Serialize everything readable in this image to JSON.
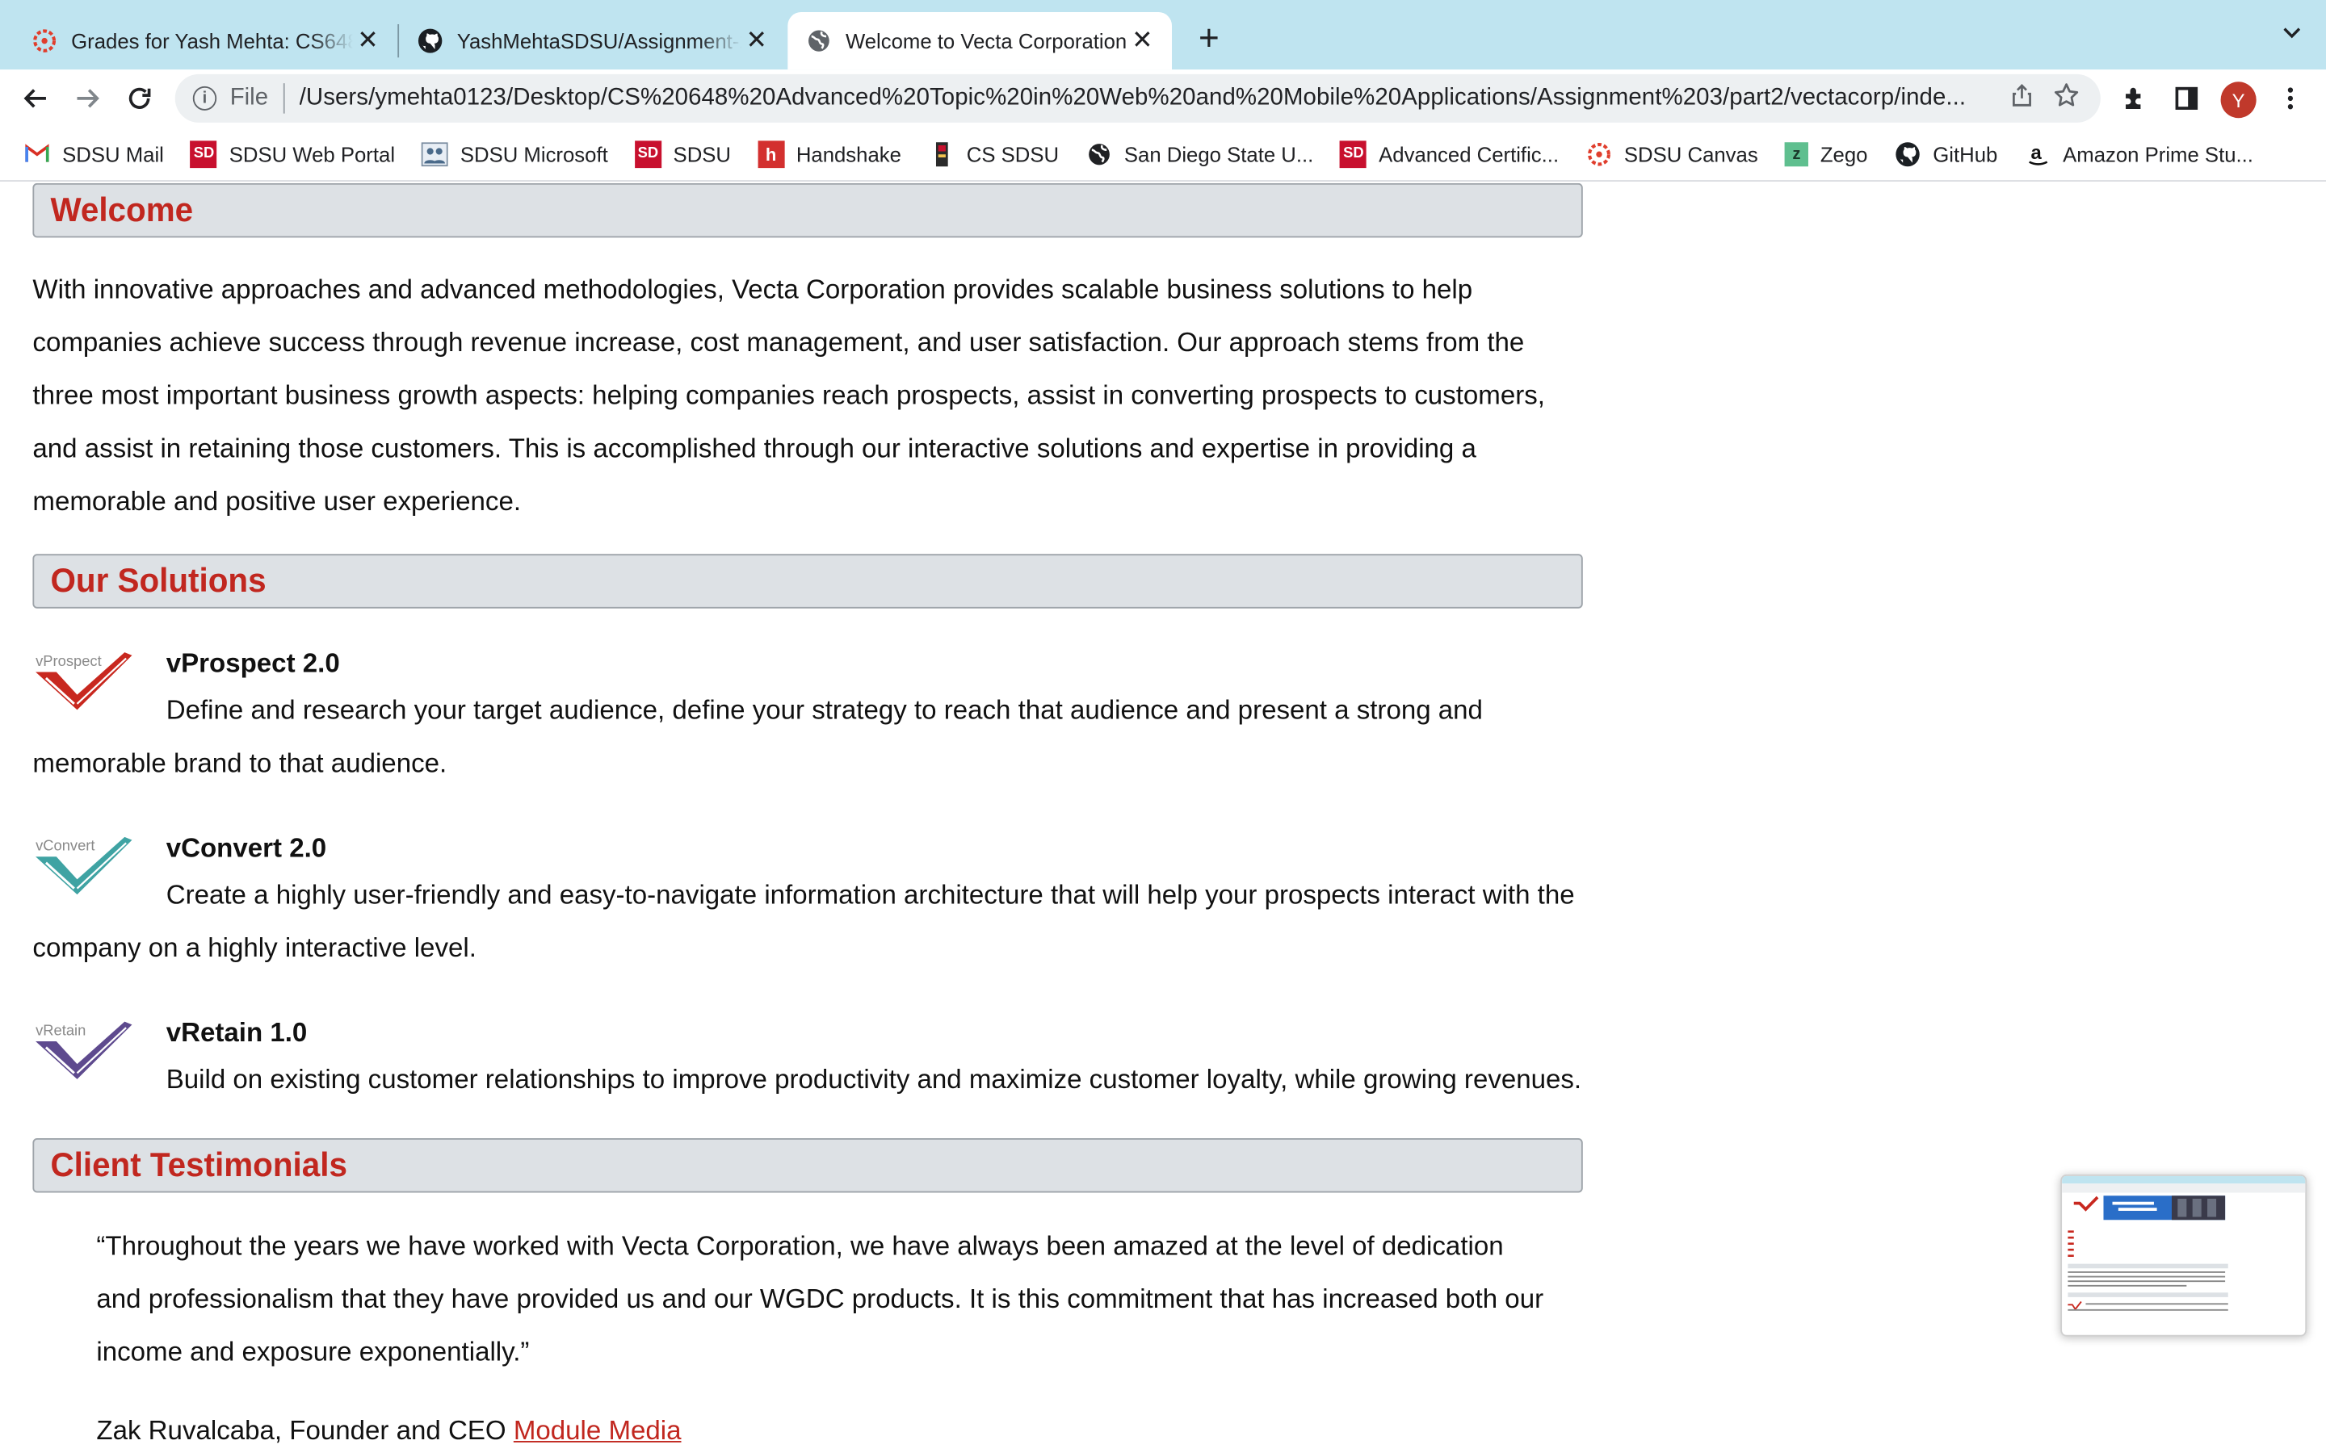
{
  "browser": {
    "tabs": [
      {
        "title": "Grades for Yash Mehta: CS648",
        "close": "✕"
      },
      {
        "title": "YashMehtaSDSU/Assignment-2",
        "close": "✕"
      },
      {
        "title": "Welcome to Vecta Corporation",
        "close": "✕"
      }
    ],
    "new_tab": "+",
    "tab_list": "⌄",
    "scheme": "File",
    "url": "/Users/ymehta0123/Desktop/CS%20648%20Advanced%20Topic%20in%20Web%20and%20Mobile%20Applications/Assignment%203/part2/vectacorp/inde...",
    "profile_initial": "Y",
    "bookmarks": [
      {
        "label": "SDSU Mail",
        "icon": "gmail-icon"
      },
      {
        "label": "SDSU Web Portal",
        "icon": "sd-icon"
      },
      {
        "label": "SDSU Microsoft",
        "icon": "people-icon"
      },
      {
        "label": "SDSU",
        "icon": "sd-icon"
      },
      {
        "label": "Handshake",
        "icon": "handshake-icon"
      },
      {
        "label": "CS SDSU",
        "icon": "aztec-icon"
      },
      {
        "label": "San Diego State U...",
        "icon": "globe-icon"
      },
      {
        "label": "Advanced Certific...",
        "icon": "sd-icon"
      },
      {
        "label": "SDSU Canvas",
        "icon": "canvas-icon"
      },
      {
        "label": "Zego",
        "icon": "zego-icon"
      },
      {
        "label": "GitHub",
        "icon": "github-icon"
      },
      {
        "label": "Amazon Prime Stu...",
        "icon": "amazon-icon"
      }
    ]
  },
  "page": {
    "welcome": {
      "heading": "Welcome",
      "text": "With innovative approaches and advanced methodologies, Vecta Corporation provides scalable business solutions to help companies achieve success through revenue increase, cost management, and user satisfaction. Our approach stems from the three most important business growth aspects: helping companies reach prospects, assist in converting prospects to customers, and assist in retaining those customers. This is accomplished through our interactive solutions and expertise in providing a memorable and positive user experience."
    },
    "solutions": {
      "heading": "Our Solutions",
      "items": [
        {
          "logo_text": "vProspect",
          "name": "vProspect 2.0",
          "desc": "Define and research your target audience, define your strategy to reach that audience and present a strong and memorable brand to that audience.",
          "color": "#c8281f"
        },
        {
          "logo_text": "vConvert",
          "name": "vConvert 2.0",
          "desc": "Create a highly user-friendly and easy-to-navigate information architecture that will help your prospects interact with the company on a highly interactive level.",
          "color": "#3fa3a3"
        },
        {
          "logo_text": "vRetain",
          "name": "vRetain 1.0",
          "desc": "Build on existing customer relationships to improve productivity and maximize customer loyalty, while growing revenues.",
          "color": "#5e4a8e"
        }
      ]
    },
    "testimonials": {
      "heading": "Client Testimonials",
      "quote": "“Throughout the years we have worked with Vecta Corporation, we have always been amazed at the level of dedication and professionalism that they have provided us and our WGDC products. It is this commitment that has increased both our income and exposure exponentially.”",
      "author": "Zak Ruvalcaba, Founder and CEO",
      "company_link": "Module Media"
    }
  },
  "colors": {
    "heading_red": "#c1271f",
    "heading_bg": "#dde1e5",
    "tabstrip": "#bfe4f0"
  }
}
